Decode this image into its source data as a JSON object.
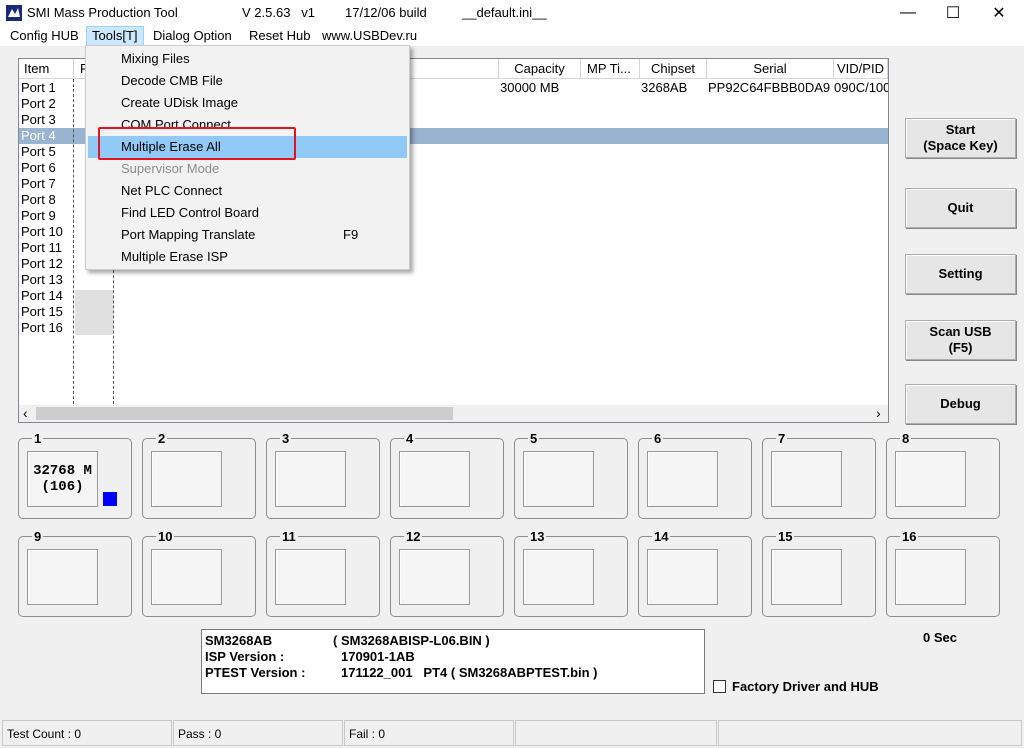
{
  "window": {
    "title": "SMI Mass Production Tool",
    "version": "V 2.5.63   v1",
    "build": "17/12/06 build",
    "ini": "__default.ini__",
    "minimize_glyph": "—",
    "maximize_glyph": "☐",
    "close_glyph": "✕"
  },
  "menu": {
    "items": [
      "Config HUB",
      "Tools[T]",
      "Dialog Option",
      "Reset Hub",
      "www.USBDev.ru"
    ]
  },
  "tools_menu": {
    "items": [
      {
        "label": "Mixing Files",
        "shortcut": "",
        "state": "normal"
      },
      {
        "label": "Decode CMB File",
        "shortcut": "",
        "state": "normal"
      },
      {
        "label": "Create UDisk Image",
        "shortcut": "",
        "state": "normal"
      },
      {
        "label": "COM Port Connect",
        "shortcut": "",
        "state": "normal"
      },
      {
        "label": "Multiple Erase All",
        "shortcut": "",
        "state": "highlighted"
      },
      {
        "label": "Supervisor Mode",
        "shortcut": "",
        "state": "disabled"
      },
      {
        "label": "Net PLC Connect",
        "shortcut": "",
        "state": "normal"
      },
      {
        "label": "Find LED Control Board",
        "shortcut": "",
        "state": "normal"
      },
      {
        "label": "Port Mapping Translate",
        "shortcut": "F9",
        "state": "normal"
      },
      {
        "label": "Multiple Erase ISP",
        "shortcut": "",
        "state": "normal"
      }
    ]
  },
  "list": {
    "columns": [
      "Item",
      "P",
      "Capacity",
      "MP Ti...",
      "Chipset",
      "Serial",
      "VID/PID"
    ],
    "ports": [
      "Port 1",
      "Port 2",
      "Port 3",
      "Port 4",
      "Port 5",
      "Port 6",
      "Port 7",
      "Port 8",
      "Port 9",
      "Port 10",
      "Port 11",
      "Port 12",
      "Port 13",
      "Port 14",
      "Port 15",
      "Port 16"
    ],
    "selected_port": "Port 4",
    "row1": {
      "capacity": "30000 MB",
      "mp_time": "",
      "chipset": "3268AB",
      "serial": "PP92C64FBBB0DA9",
      "vidpid": "090C/100"
    },
    "scroll_left": "‹",
    "scroll_right": "›"
  },
  "buttons": {
    "start": [
      "Start",
      "(Space Key)"
    ],
    "quit": "Quit",
    "setting": "Setting",
    "scan": [
      "Scan USB",
      "(F5)"
    ],
    "debug": "Debug"
  },
  "port_boxes": {
    "numbers": [
      "1",
      "2",
      "3",
      "4",
      "5",
      "6",
      "7",
      "8",
      "9",
      "10",
      "11",
      "12",
      "13",
      "14",
      "15",
      "16"
    ],
    "port1_line1": "32768 M",
    "port1_line2": "(106)",
    "port1_indicator_color": "#0000ff"
  },
  "info": {
    "line1_left": "SM3268AB",
    "line1_right": "( SM3268ABISP-L06.BIN )",
    "line2_left": "ISP Version :",
    "line2_right": "170901-1AB",
    "line3_left": "PTEST Version :",
    "line3_right": "171122_001   PT4 ( SM3268ABPTEST.bin )"
  },
  "timer": "0 Sec",
  "factory_checkbox": {
    "label": "Factory Driver and HUB",
    "checked": false
  },
  "status": {
    "test_count": "Test Count : 0",
    "pass": "Pass : 0",
    "fail": "Fail : 0"
  },
  "colors": {
    "selection": "#99b4d1",
    "menu_highlight": "#91c9f7",
    "annotation_red": "#e3141d"
  }
}
